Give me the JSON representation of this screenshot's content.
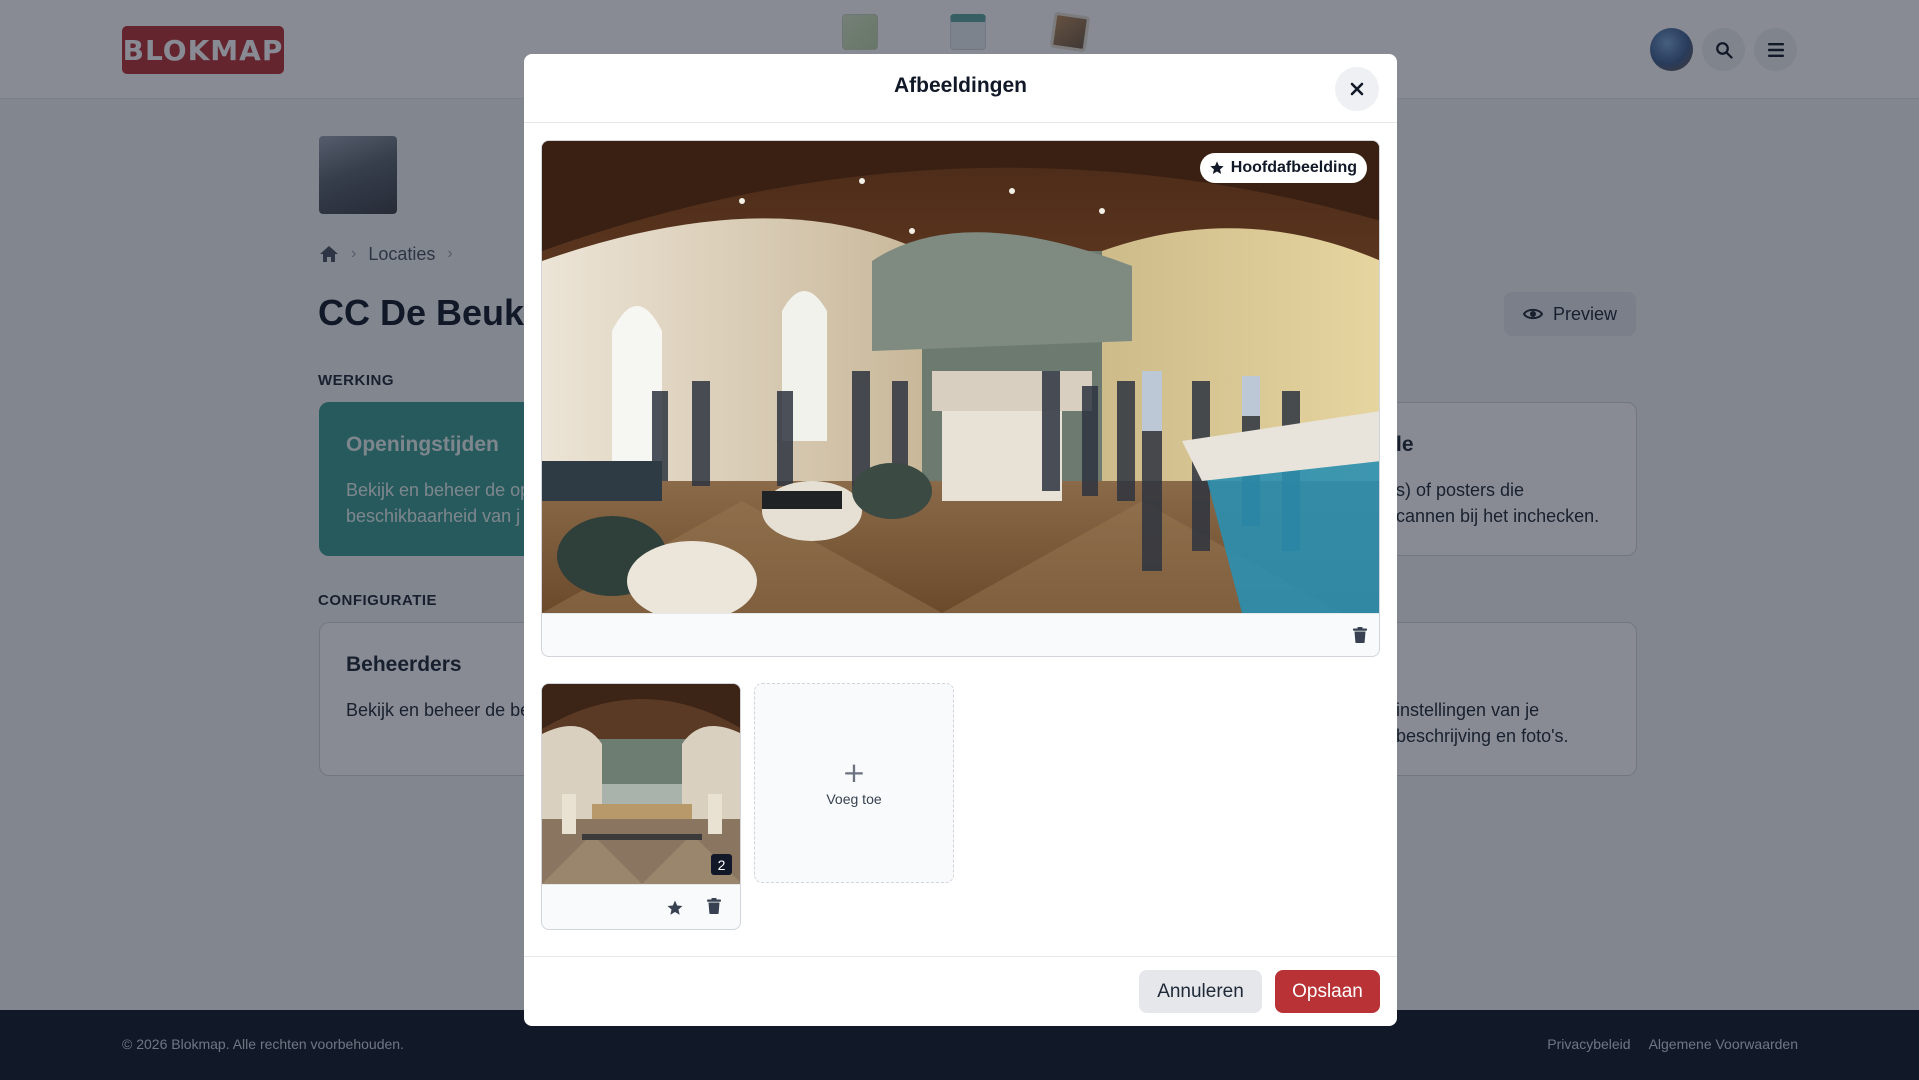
{
  "app": {
    "logo_text": "BLOKMAP"
  },
  "nav": {
    "icons": [
      "map-icon",
      "calendar-icon",
      "photos-icon"
    ]
  },
  "page": {
    "breadcrumb": [
      "Locaties"
    ],
    "title": "CC De Beuk",
    "preview_label": "Preview",
    "sections": {
      "werking": "WERKING",
      "configuratie": "CONFIGURATIE"
    },
    "cards": {
      "opening_title": "Openingstijden",
      "opening_text": "Bekijk en beheer de op",
      "opening_text2": "beschikbaarheid van j",
      "admins_title": "Beheerders",
      "admins_text": "Bekijk en beheer de be",
      "right_top_title": "le",
      "right_top_text": "s) of posters die",
      "right_top_text2": "cannen bij het inchecken.",
      "right_bottom_text": "instellingen van je",
      "right_bottom_text2": "beschrijving en foto's."
    }
  },
  "footer": {
    "copyright": "© 2026 Blokmap. Alle rechten voorbehouden.",
    "links": [
      "Privacybeleid",
      "Algemene Voorwaarden"
    ]
  },
  "modal": {
    "title": "Afbeeldingen",
    "main_badge": "Hoofdafbeelding",
    "thumb_count": "2",
    "add_label": "Voeg toe",
    "add_symbol": "+",
    "cancel_label": "Annuleren",
    "save_label": "Opslaan"
  },
  "colors": {
    "brand": "#b83236",
    "teal": "#3c9c91",
    "footer_bg": "#111827"
  }
}
